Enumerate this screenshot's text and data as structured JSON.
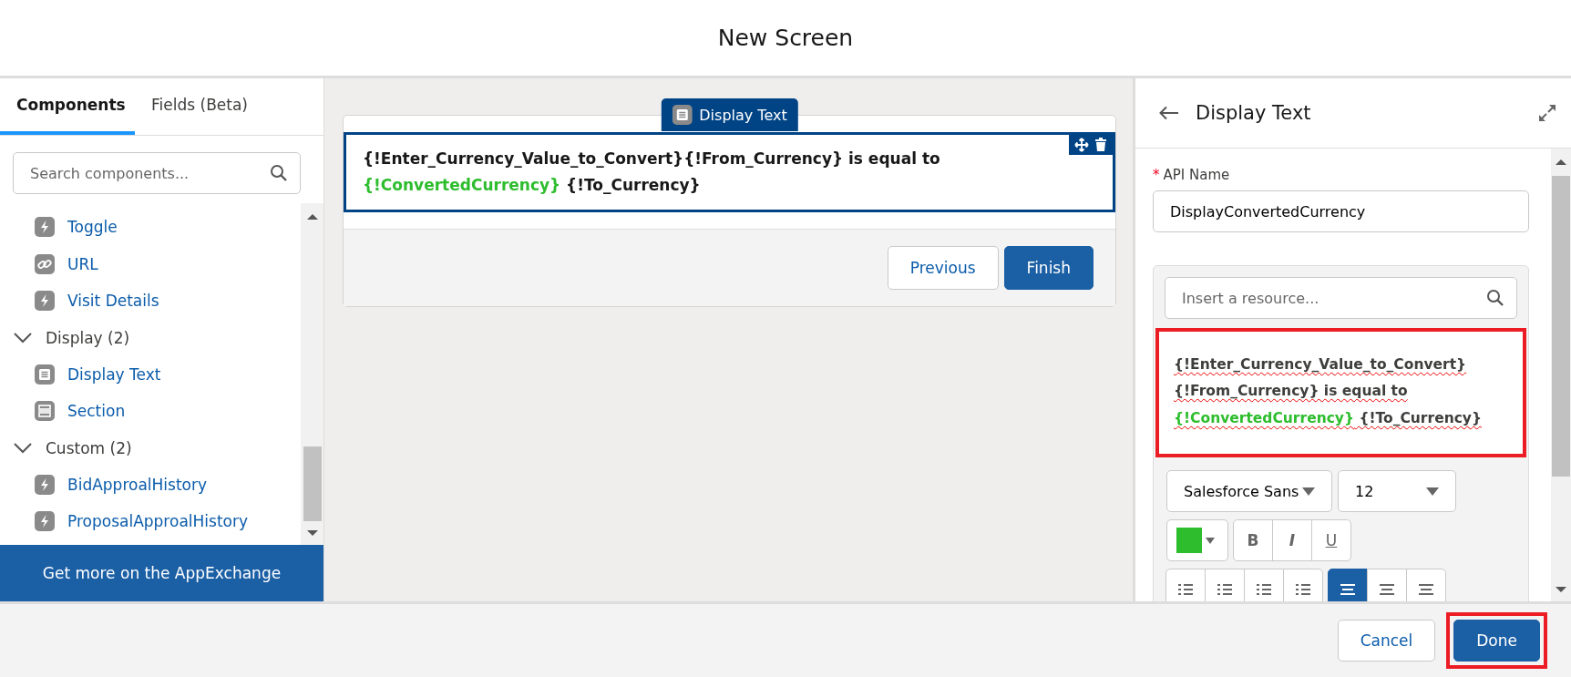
{
  "window": {
    "title": "New Screen"
  },
  "sidebar": {
    "tabs": [
      {
        "label": "Components",
        "selected": true
      },
      {
        "label": "Fields (Beta)",
        "selected": false
      }
    ],
    "search": {
      "placeholder": "Search components..."
    },
    "items": [
      {
        "kind": "bolt",
        "label": "Toggle"
      },
      {
        "kind": "link",
        "label": "URL"
      },
      {
        "kind": "bolt",
        "label": "Visit Details"
      },
      {
        "kind": "group",
        "label": "Display (2)",
        "expanded": true
      },
      {
        "kind": "text",
        "label": "Display Text"
      },
      {
        "kind": "section",
        "label": "Section"
      },
      {
        "kind": "group",
        "label": "Custom (2)",
        "expanded": true
      },
      {
        "kind": "bolt",
        "label": "BidApproalHistory"
      },
      {
        "kind": "bolt",
        "label": "ProposalApproalHistory"
      }
    ],
    "appexchange_button": "Get more on the AppExchange"
  },
  "canvas": {
    "component_tab": "Display Text",
    "text": [
      {
        "text": "{!Enter_Currency_Value_to_Convert}{!From_Currency} is equal to ",
        "color": "#181818"
      },
      {
        "text": "{!ConvertedCurrency}",
        "color": "#2dbd2d"
      },
      {
        "text": " {!To_Currency}",
        "color": "#181818"
      }
    ],
    "buttons": [
      {
        "label": "Previous",
        "kind": "neutral"
      },
      {
        "label": "Finish",
        "kind": "brand"
      }
    ]
  },
  "properties": {
    "title": "Display Text",
    "api_name": {
      "label": "API Name",
      "required_marker": "*",
      "value": "DisplayConvertedCurrency"
    },
    "resource_search": {
      "placeholder": "Insert a resource..."
    },
    "editor": {
      "highlighted": true,
      "lines": [
        [
          {
            "text": "{!Enter_Currency_Value_to_Convert}",
            "color": "#3e3e3c"
          }
        ],
        [
          {
            "text": "{!From_Currency} is equal to",
            "color": "#3e3e3c"
          }
        ],
        [
          {
            "text": "{!ConvertedCurrency}",
            "color": "#2dbd2d"
          },
          {
            "text": " {!To_Currency}",
            "color": "#3e3e3c"
          }
        ]
      ]
    },
    "font_family": "Salesforce Sans",
    "font_size": "12",
    "format_buttons": [
      {
        "label": "B",
        "kind": "bold"
      },
      {
        "label": "I",
        "kind": "italic"
      },
      {
        "label": "U",
        "kind": "underline"
      }
    ],
    "align_buttons": [
      {
        "selected": true
      },
      {
        "selected": false
      },
      {
        "selected": false
      }
    ]
  },
  "footer": {
    "buttons": [
      {
        "label": "Cancel",
        "kind": "neutral"
      },
      {
        "label": "Done",
        "kind": "brand",
        "highlighted": true
      }
    ]
  }
}
